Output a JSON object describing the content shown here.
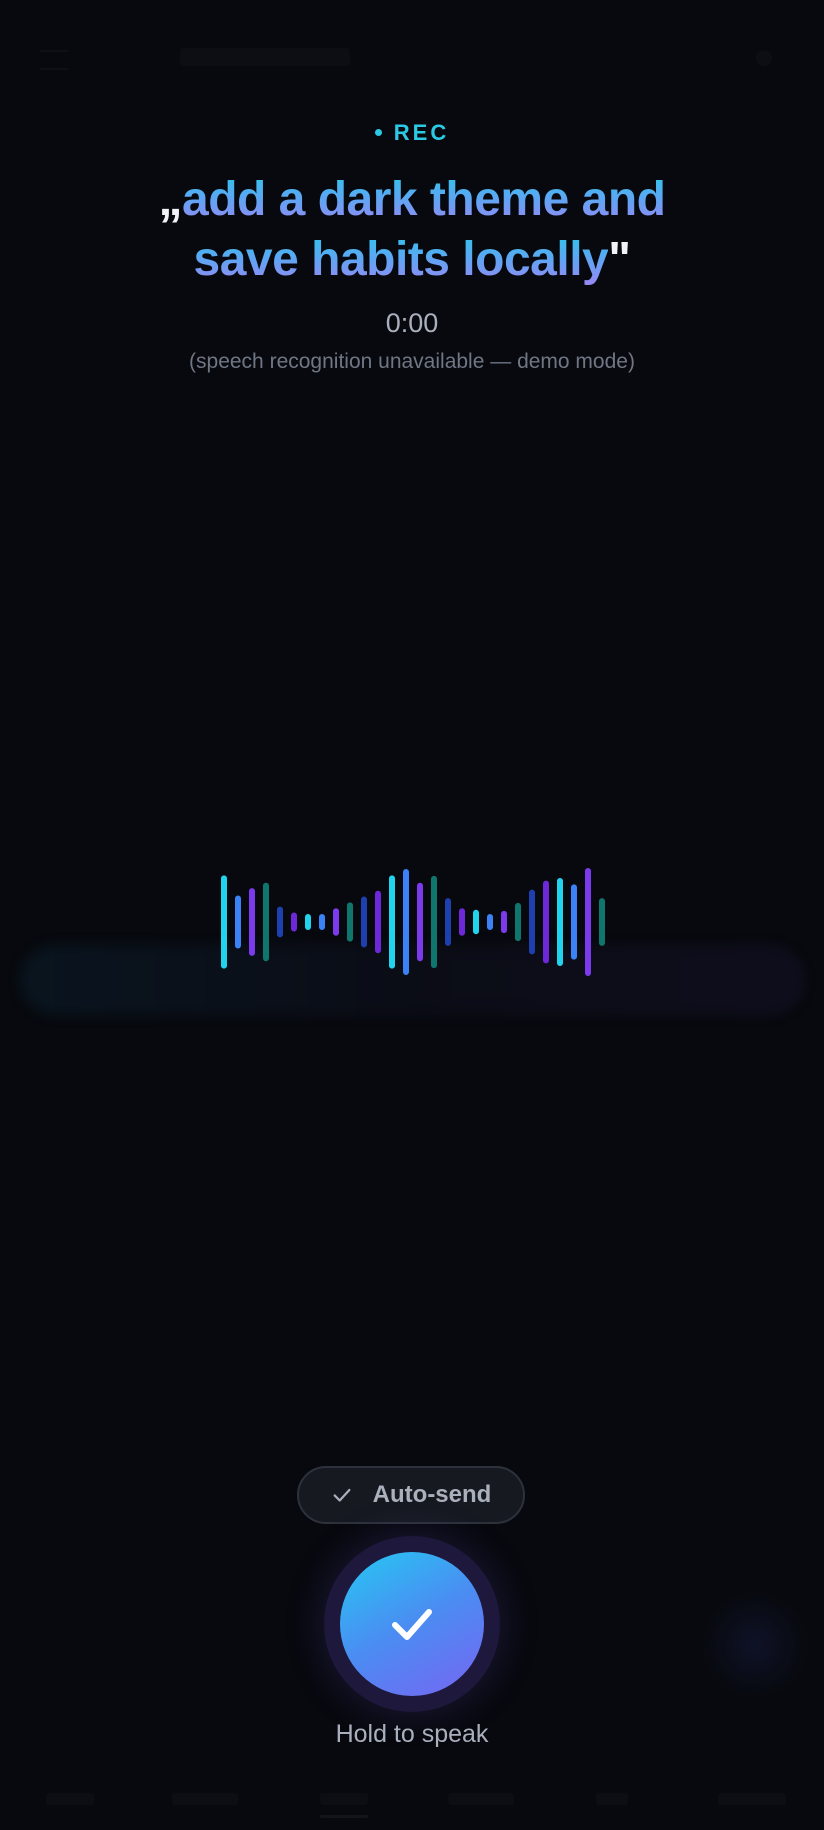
{
  "recording": {
    "label": "REC",
    "transcript_open_quote": "„",
    "transcript_text": "add a dark theme and save habits locally",
    "transcript_close_quote": "\"",
    "timer": "0:00",
    "status_note": "(speech recognition unavailable — demo mode)"
  },
  "waveform": {
    "bars": [
      {
        "level": 0.88,
        "color": "#22d3ee"
      },
      {
        "level": 0.5,
        "color": "#3b82f6"
      },
      {
        "level": 0.64,
        "color": "#7c3aed"
      },
      {
        "level": 0.74,
        "color": "#0f766e"
      },
      {
        "level": 0.29,
        "color": "#1e40af"
      },
      {
        "level": 0.18,
        "color": "#6d28d9"
      },
      {
        "level": 0.15,
        "color": "#22d3ee"
      },
      {
        "level": 0.15,
        "color": "#3b82f6"
      },
      {
        "level": 0.26,
        "color": "#7c3aed"
      },
      {
        "level": 0.37,
        "color": "#0f766e"
      },
      {
        "level": 0.48,
        "color": "#1e40af"
      },
      {
        "level": 0.59,
        "color": "#6d28d9"
      },
      {
        "level": 0.88,
        "color": "#22d3ee"
      },
      {
        "level": 1.0,
        "color": "#3b82f6"
      },
      {
        "level": 0.74,
        "color": "#7c3aed"
      },
      {
        "level": 0.87,
        "color": "#0f766e"
      },
      {
        "level": 0.45,
        "color": "#1e40af"
      },
      {
        "level": 0.26,
        "color": "#6d28d9"
      },
      {
        "level": 0.23,
        "color": "#22d3ee"
      },
      {
        "level": 0.15,
        "color": "#3b82f6"
      },
      {
        "level": 0.21,
        "color": "#7c3aed"
      },
      {
        "level": 0.36,
        "color": "#0f766e"
      },
      {
        "level": 0.61,
        "color": "#1e40af"
      },
      {
        "level": 0.78,
        "color": "#6d28d9"
      },
      {
        "level": 0.83,
        "color": "#22d3ee"
      },
      {
        "level": 0.71,
        "color": "#3b82f6"
      },
      {
        "level": 1.02,
        "color": "#7c3aed"
      },
      {
        "level": 0.45,
        "color": "#0f766e"
      }
    ]
  },
  "controls": {
    "autosend_label": "Auto-send",
    "autosend_checked": true,
    "hold_label": "Hold to speak"
  },
  "colors": {
    "background": "#07090e",
    "accent_cyan": "#2cc9e4",
    "accent_violet": "#7765f2"
  },
  "icons": {
    "autosend": "check-icon",
    "mic_button": "check-icon"
  }
}
